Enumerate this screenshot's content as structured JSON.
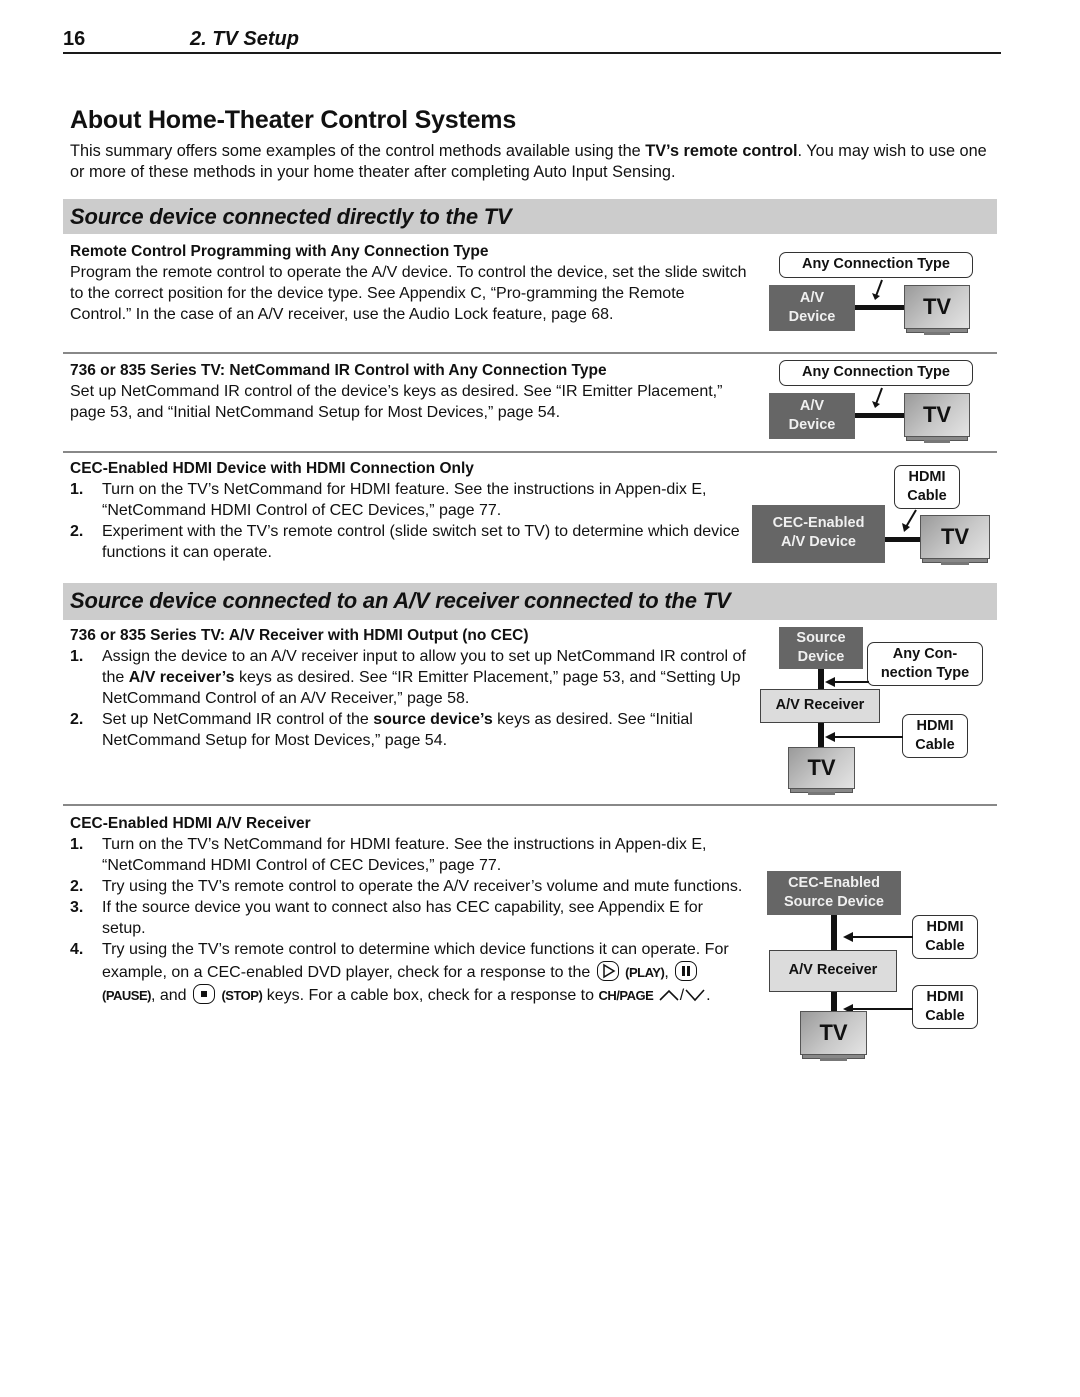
{
  "header": {
    "page_number": "16",
    "chapter": "2.  TV Setup"
  },
  "title": "About Home-Theater Control Systems",
  "intro": {
    "before_bold": "This summary offers some examples of the control methods available using the ",
    "bold": "TV’s remote control",
    "after_bold": ".  You may wish to use one or more of these methods in your home theater after completing Auto Input Sensing."
  },
  "sections": [
    {
      "title": "Source device connected directly to the TV",
      "blocks": [
        {
          "heading": "Remote Control Programming with Any Connection Type",
          "body": "Program the remote control to operate the A/V device.  To control the device, set the slide switch to the correct position for the device type.  See Appendix  C, “Pro-gramming the Remote Control.”  In the case of an A/V receiver, use the Audio Lock feature, page 68.",
          "diagram": {
            "callout": "Any Connection Type",
            "device": "A/V Device",
            "tv": "TV"
          }
        },
        {
          "heading": "736 or 835 Series TV:  NetCommand IR Control with Any Connection Type",
          "body": "Set up NetCommand IR control of the device’s keys as desired.  See “IR Emitter Placement,” page 53, and “Initial NetCommand Setup for Most Devices,” page 54.",
          "diagram": {
            "callout": "Any Connection Type",
            "device": "A/V Device",
            "tv": "TV"
          }
        },
        {
          "heading": "CEC-Enabled HDMI Device with HDMI Connection Only",
          "steps": [
            "Turn on the TV’s NetCommand for HDMI feature.  See the instructions in Appen-dix E, “NetCommand HDMI Control of CEC Devices,” page 77.",
            "Experiment with the TV’s remote control (slide switch set to TV) to determine which device functions it can operate."
          ],
          "diagram": {
            "callout": "HDMI Cable",
            "device": "CEC-Enabled A/V Device",
            "tv": "TV"
          }
        }
      ]
    },
    {
      "title": "Source device connected to an A/V receiver connected to the TV",
      "blocks": [
        {
          "heading": "736 or 835 Series TV:  A/V Receiver with HDMI Output (no CEC)",
          "steps": [
            {
              "pre": "Assign the device to an A/V receiver input to allow you to set up NetCommand IR control of the ",
              "bold": "A/V receiver’s",
              "post": " keys as desired.  See “IR Emitter Placement,” page 53, and “Setting Up NetCommand Control of an A/V Receiver,” page 58."
            },
            {
              "pre": "Set up NetCommand IR control of the ",
              "bold": "source device’s",
              "post": " keys as desired.  See “Initial NetCommand Setup for Most Devices,” page 54."
            }
          ],
          "diagram": {
            "source": "Source Device",
            "callout_top": "Any Con-nection Type",
            "receiver": "A/V Receiver",
            "callout_bottom": "HDMI Cable",
            "tv": "TV"
          }
        },
        {
          "heading": "CEC-Enabled HDMI A/V Receiver",
          "steps": [
            "Turn on the TV’s NetCommand for HDMI feature.  See the instructions in Appen-dix E, “NetCommand HDMI Control of CEC Devices,” page 77.",
            "Try using the TV’s remote control to operate the A/V receiver’s volume and mute functions.",
            "If the source device you want to connect also has CEC capability, see Appendix E for setup.",
            {
              "pre": "Try using the TV’s remote control to determine which device functions it can operate.  For example, on a CEC-enabled DVD player, check for a response to the ",
              "play_label": "(PLAY)",
              "pause_label": "(PAUSE)",
              "and": ", and ",
              "stop_label": "(STOP)",
              "mid": " keys.  For a cable box, check for a response to ",
              "ch_label": "CH/PAGE",
              "slash": "/",
              "end": "."
            }
          ],
          "diagram": {
            "source": "CEC-Enabled Source Device",
            "callout_top": "HDMI Cable",
            "receiver": "A/V Receiver",
            "callout_bottom": "HDMI Cable",
            "tv": "TV"
          }
        }
      ]
    }
  ],
  "icons": {
    "play": "play-key-icon",
    "pause": "pause-key-icon",
    "stop": "stop-key-icon",
    "up": "chevron-up-icon",
    "down": "chevron-down-icon"
  },
  "colors": {
    "section_bar": "#cccccc",
    "device_box": "#666666",
    "receiver_box": "#dcdcdc",
    "divider": "#888888"
  }
}
